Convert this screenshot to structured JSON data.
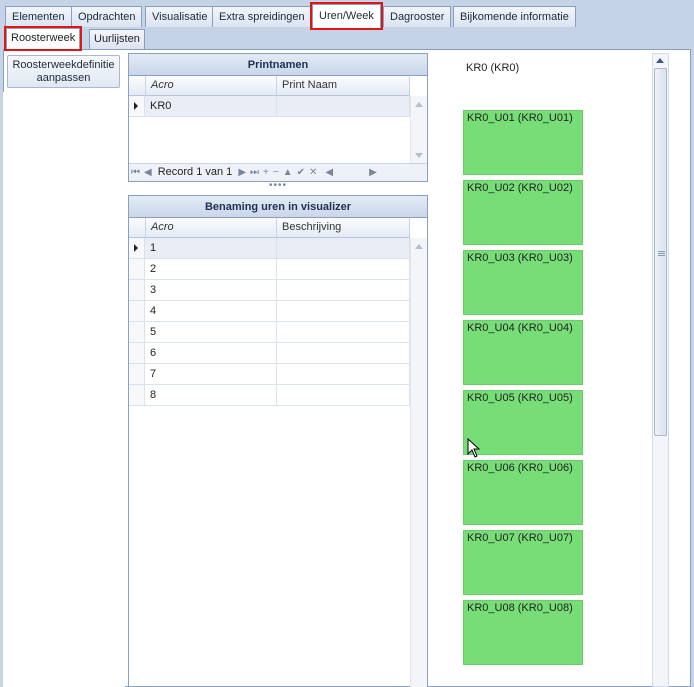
{
  "tabs": [
    {
      "label": "Elementen"
    },
    {
      "label": "Opdrachten"
    },
    {
      "label": "Visualisatie"
    },
    {
      "label": "Extra spreidingen"
    },
    {
      "label": "Uren/Week"
    },
    {
      "label": "Dagrooster"
    },
    {
      "label": "Bijkomende informatie"
    }
  ],
  "subtabs": [
    {
      "label": "Roosterweek"
    },
    {
      "label": "Uurlijsten"
    }
  ],
  "left_button": {
    "line1": "Roosterweekdefinitie",
    "line2": "aanpassen"
  },
  "printnamen": {
    "title": "Printnamen",
    "columns": [
      "Acro",
      "Print Naam"
    ],
    "rows": [
      {
        "acro": "KR0",
        "print_naam": ""
      }
    ],
    "navigator": {
      "record_text": "Record 1 van 1"
    }
  },
  "benaming": {
    "title": "Benaming uren in visualizer",
    "columns": [
      "Acro",
      "Beschrijving"
    ],
    "rows": [
      {
        "acro": "1",
        "beschrijving": ""
      },
      {
        "acro": "2",
        "beschrijving": ""
      },
      {
        "acro": "3",
        "beschrijving": ""
      },
      {
        "acro": "4",
        "beschrijving": ""
      },
      {
        "acro": "5",
        "beschrijving": ""
      },
      {
        "acro": "6",
        "beschrijving": ""
      },
      {
        "acro": "7",
        "beschrijving": ""
      },
      {
        "acro": "8",
        "beschrijving": ""
      }
    ]
  },
  "visualizer": {
    "title": "KR0 (KR0)",
    "block_color": "#77dd77",
    "blocks": [
      "KR0_U01 (KR0_U01)",
      "KR0_U02 (KR0_U02)",
      "KR0_U03 (KR0_U03)",
      "KR0_U04 (KR0_U04)",
      "KR0_U05 (KR0_U05)",
      "KR0_U06 (KR0_U06)",
      "KR0_U07 (KR0_U07)",
      "KR0_U08 (KR0_U08)"
    ]
  },
  "highlight_color": "#e01515"
}
